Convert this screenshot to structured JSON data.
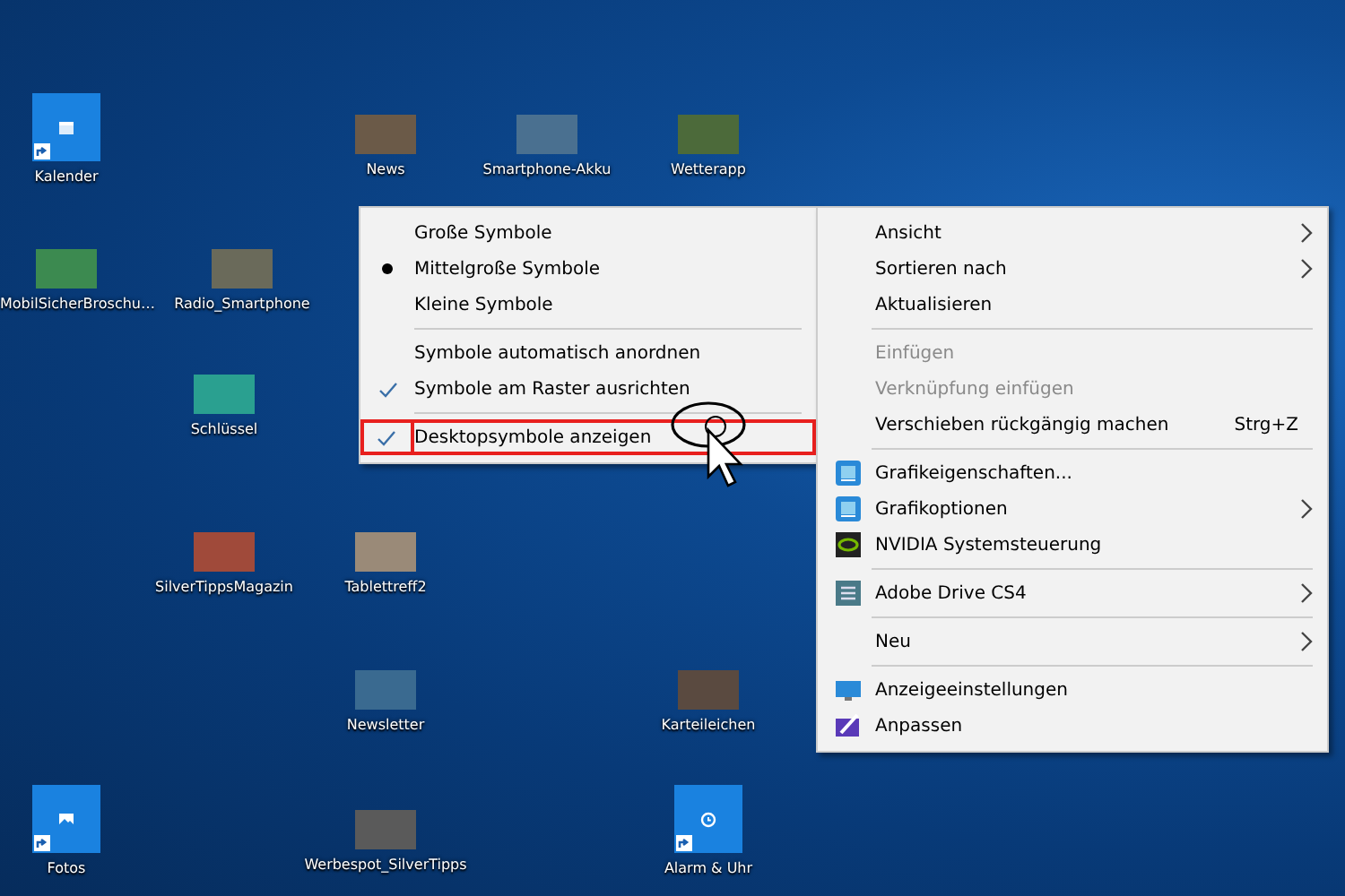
{
  "desktop_icons": [
    {
      "label": "Kalender",
      "kind": "tile"
    },
    {
      "label": "News",
      "kind": "thumbnail"
    },
    {
      "label": "Smartphone-Akku",
      "kind": "thumbnail"
    },
    {
      "label": "Wetterapp",
      "kind": "thumbnail"
    },
    {
      "label": "MobilSicherBroschu…",
      "kind": "thumbnail"
    },
    {
      "label": "Radio_Smartphone",
      "kind": "thumbnail"
    },
    {
      "label": "Schlüssel",
      "kind": "thumbnail"
    },
    {
      "label": "SilverTippsMagazin",
      "kind": "thumbnail"
    },
    {
      "label": "Tablettreff2",
      "kind": "thumbnail"
    },
    {
      "label": "Newsletter",
      "kind": "thumbnail"
    },
    {
      "label": "Karteileichen",
      "kind": "thumbnail"
    },
    {
      "label": "Fotos",
      "kind": "tile"
    },
    {
      "label": "Werbespot_SilverTipps",
      "kind": "thumbnail"
    },
    {
      "label": "Alarm & Uhr",
      "kind": "tile"
    }
  ],
  "view_submenu": {
    "groups": [
      [
        {
          "label": "Große Symbole",
          "kind": "radio",
          "selected": false,
          "highlighted": false
        },
        {
          "label": "Mittelgroße Symbole",
          "kind": "radio",
          "selected": true,
          "highlighted": false
        },
        {
          "label": "Kleine Symbole",
          "kind": "radio",
          "selected": false,
          "highlighted": false
        }
      ],
      [
        {
          "label": "Symbole automatisch anordnen",
          "kind": "check",
          "checked": false,
          "highlighted": false
        },
        {
          "label": "Symbole am Raster ausrichten",
          "kind": "check",
          "checked": true,
          "highlighted": false
        }
      ],
      [
        {
          "label": "Desktopsymbole anzeigen",
          "kind": "check",
          "checked": true,
          "highlighted": true
        }
      ]
    ]
  },
  "context_menu": {
    "groups": [
      [
        {
          "label": "Ansicht",
          "submenu": true,
          "disabled": false
        },
        {
          "label": "Sortieren nach",
          "submenu": true,
          "disabled": false
        },
        {
          "label": "Aktualisieren",
          "submenu": false,
          "disabled": false
        }
      ],
      [
        {
          "label": "Einfügen",
          "submenu": false,
          "disabled": true
        },
        {
          "label": "Verknüpfung einfügen",
          "submenu": false,
          "disabled": true
        },
        {
          "label": "Verschieben rückgängig machen",
          "submenu": false,
          "disabled": false,
          "shortcut": "Strg+Z"
        }
      ],
      [
        {
          "label": "Grafikeigenschaften...",
          "submenu": false,
          "disabled": false
        },
        {
          "label": "Grafikoptionen",
          "submenu": true,
          "disabled": false
        },
        {
          "label": "NVIDIA Systemsteuerung",
          "submenu": false,
          "disabled": false
        }
      ],
      [
        {
          "label": "Adobe Drive CS4",
          "submenu": true,
          "disabled": false
        }
      ],
      [
        {
          "label": "Neu",
          "submenu": true,
          "disabled": false
        }
      ],
      [
        {
          "label": "Anzeigeeinstellungen",
          "submenu": false,
          "disabled": false
        },
        {
          "label": "Anpassen",
          "submenu": false,
          "disabled": false
        }
      ]
    ]
  }
}
